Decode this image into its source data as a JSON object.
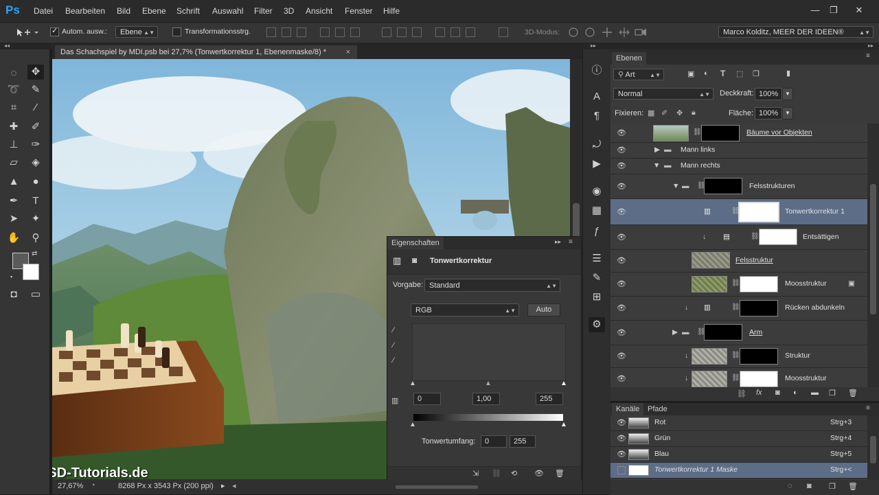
{
  "app": {
    "logo": "Ps"
  },
  "menu": [
    "Datei",
    "Bearbeiten",
    "Bild",
    "Ebene",
    "Schrift",
    "Auswahl",
    "Filter",
    "3D",
    "Ansicht",
    "Fenster",
    "Hilfe"
  ],
  "window_buttons": [
    "—",
    "❐",
    "✕"
  ],
  "options": {
    "auto_select_label": "Autom. ausw.:",
    "auto_select_checked": true,
    "auto_select_value": "Ebene",
    "transform_label": "Transformationsstrg.",
    "mode3d_label": "3D-Modus:",
    "workspace": "Marco Kolditz, MEER DER IDEEN®"
  },
  "document": {
    "tab_title": "Das Schachspiel by MDI.psb bei 27,7% (Tonwertkorrektur 1, Ebenenmaske/8) *",
    "close": "×",
    "zoom": "27,67%",
    "doc_info": "8268 Px x 3543 Px (200 ppi)",
    "watermark": "PSD-Tutorials.de"
  },
  "layers_panel": {
    "tab": "Ebenen",
    "filter_label": "Art",
    "blend_mode": "Normal",
    "opacity_label": "Deckkraft:",
    "opacity": "100%",
    "lock_label": "Fixieren:",
    "fill_label": "Fläche:",
    "fill": "100%",
    "layers": [
      {
        "name": "Bäume vor Objekten",
        "selected": false
      },
      {
        "name": "Mann links",
        "selected": false
      },
      {
        "name": "Mann rechts",
        "selected": false
      },
      {
        "name": "Felsstrukturen",
        "selected": false
      },
      {
        "name": "Tonwertkorrektur 1",
        "selected": true
      },
      {
        "name": "Entsättigen",
        "selected": false
      },
      {
        "name": "Felsstruktur",
        "selected": false
      },
      {
        "name": "Moosstruktur",
        "selected": false
      },
      {
        "name": "Rücken abdunkeln",
        "selected": false
      },
      {
        "name": "Arm",
        "selected": false
      },
      {
        "name": "Struktur",
        "selected": false
      },
      {
        "name": "Moosstruktur",
        "selected": false
      }
    ]
  },
  "channels_panel": {
    "tabs": [
      "Kanäle",
      "Pfade"
    ],
    "channels": [
      {
        "name": "Rot",
        "shortcut": "Strg+3"
      },
      {
        "name": "Grün",
        "shortcut": "Strg+4"
      },
      {
        "name": "Blau",
        "shortcut": "Strg+5"
      },
      {
        "name": "Tonwertkorrektur 1 Maske",
        "shortcut": "Strg+<"
      }
    ]
  },
  "properties_panel": {
    "tab": "Eigenschaften",
    "title": "Tonwertkorrektur",
    "preset_label": "Vorgabe:",
    "preset": "Standard",
    "channel": "RGB",
    "auto_button": "Auto",
    "input_black": "0",
    "input_gamma": "1,00",
    "input_white": "255",
    "output_label": "Tonwertumfang:",
    "output_black": "0",
    "output_white": "255"
  },
  "colors": {
    "accent": "#2fa3f6",
    "selected_row": "#5d6d87"
  }
}
